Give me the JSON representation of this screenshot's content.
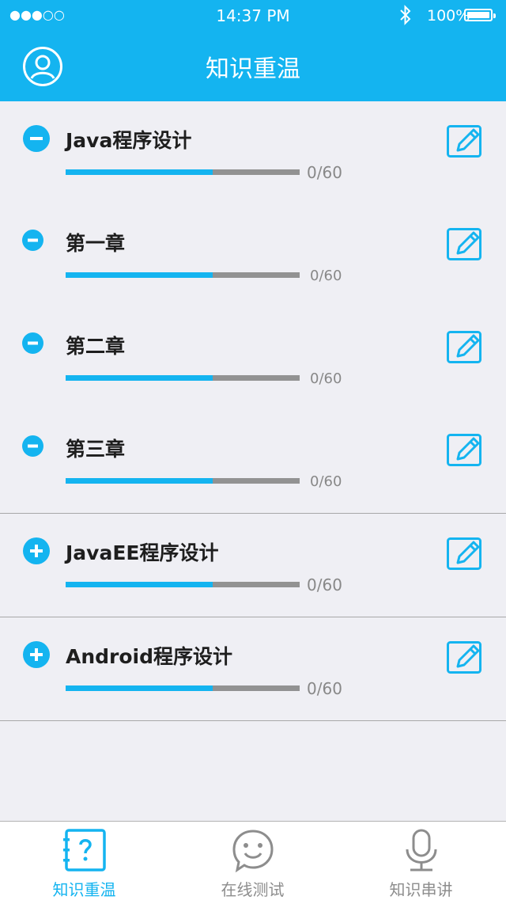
{
  "status_bar": {
    "signal": "●●●○○",
    "time": "14:37 PM",
    "battery": "100%",
    "bluetooth_icon": "bluetooth-icon"
  },
  "header": {
    "title": "知识重温",
    "user_icon": "user-profile-icon"
  },
  "colors": {
    "accent": "#14b4f0",
    "progress_remaining": "#929292",
    "background": "#efeff4"
  },
  "courses": [
    {
      "title": "Java程序设计",
      "progress_text": "0/60",
      "progress_fraction": 0.63,
      "state": "expanded",
      "toggle_icon": "minus-circle-icon",
      "edit_icon": "edit-icon"
    },
    {
      "title": "第一章",
      "progress_text": "0/60",
      "progress_fraction": 0.63,
      "state": "chapter",
      "toggle_icon": "minus-circle-icon",
      "edit_icon": "edit-icon"
    },
    {
      "title": "第二章",
      "progress_text": "0/60",
      "progress_fraction": 0.63,
      "state": "chapter",
      "toggle_icon": "minus-circle-icon",
      "edit_icon": "edit-icon"
    },
    {
      "title": "第三章",
      "progress_text": "0/60",
      "progress_fraction": 0.63,
      "state": "chapter",
      "toggle_icon": "minus-circle-icon",
      "edit_icon": "edit-icon"
    },
    {
      "title": "JavaEE程序设计",
      "progress_text": "0/60",
      "progress_fraction": 0.63,
      "state": "collapsed",
      "toggle_icon": "plus-circle-icon",
      "edit_icon": "edit-icon"
    },
    {
      "title": "Android程序设计",
      "progress_text": "0/60",
      "progress_fraction": 0.63,
      "state": "collapsed",
      "toggle_icon": "plus-circle-icon",
      "edit_icon": "edit-icon"
    }
  ],
  "tabs": [
    {
      "label": "知识重温",
      "icon": "question-book-icon",
      "active": true
    },
    {
      "label": "在线测试",
      "icon": "smiley-chat-icon",
      "active": false
    },
    {
      "label": "知识串讲",
      "icon": "microphone-icon",
      "active": false
    }
  ]
}
